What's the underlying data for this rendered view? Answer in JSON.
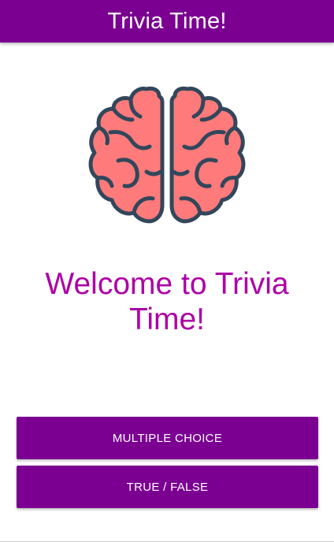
{
  "app_bar": {
    "title": "Trivia Time!"
  },
  "hero": {
    "icon": "brain-icon",
    "welcome_text": "Welcome to Trivia Time!"
  },
  "buttons": {
    "multiple_choice": "MULTIPLE CHOICE",
    "true_false": "TRUE / FALSE"
  },
  "colors": {
    "primary": "#7b0092",
    "title_text": "#ad00a6",
    "brain_fill": "#ff7b7b",
    "brain_outline": "#32475b"
  }
}
